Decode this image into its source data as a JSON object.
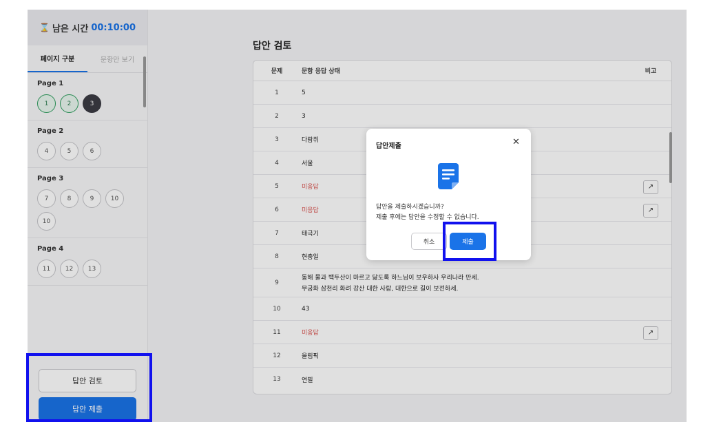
{
  "timer": {
    "label": "남은 시간",
    "value": "00:10:00"
  },
  "tabs": [
    {
      "label": "페이지 구분",
      "active": true
    },
    {
      "label": "문항만 보기",
      "active": false
    }
  ],
  "pages": [
    {
      "label": "Page 1",
      "questions": [
        {
          "n": "1",
          "state": "answered"
        },
        {
          "n": "2",
          "state": "answered"
        },
        {
          "n": "3",
          "state": "current"
        }
      ]
    },
    {
      "label": "Page 2",
      "questions": [
        {
          "n": "4",
          "state": ""
        },
        {
          "n": "5",
          "state": ""
        },
        {
          "n": "6",
          "state": ""
        }
      ]
    },
    {
      "label": "Page 3",
      "questions": [
        {
          "n": "7",
          "state": ""
        },
        {
          "n": "8",
          "state": ""
        },
        {
          "n": "9",
          "state": ""
        },
        {
          "n": "10",
          "state": ""
        },
        {
          "n": "10",
          "state": ""
        }
      ]
    },
    {
      "label": "Page 4",
      "questions": [
        {
          "n": "11",
          "state": ""
        },
        {
          "n": "12",
          "state": ""
        },
        {
          "n": "13",
          "state": ""
        }
      ]
    }
  ],
  "sidebar_buttons": {
    "review": "답안 검토",
    "submit": "답안 제출"
  },
  "main": {
    "title": "답안 검토",
    "columns": {
      "num": "문제",
      "status": "문항 응답 상태",
      "note": "비고"
    },
    "rows": [
      {
        "num": "1",
        "status": "5",
        "unanswered": false,
        "link": false
      },
      {
        "num": "2",
        "status": "3",
        "unanswered": false,
        "link": false
      },
      {
        "num": "3",
        "status": "다람쥐",
        "unanswered": false,
        "link": false
      },
      {
        "num": "4",
        "status": "서울",
        "unanswered": false,
        "link": false
      },
      {
        "num": "5",
        "status": "미응답",
        "unanswered": true,
        "link": true
      },
      {
        "num": "6",
        "status": "미응답",
        "unanswered": true,
        "link": true
      },
      {
        "num": "7",
        "status": "태극기",
        "unanswered": false,
        "link": false
      },
      {
        "num": "8",
        "status": "현충일",
        "unanswered": false,
        "link": false
      },
      {
        "num": "9",
        "status": "동해 물과 백두산이 마르고 닳도록 하느님이 보우하사 우리나라 만세.",
        "status2": "무궁화 삼천리 화려 강산 대한 사람, 대한으로 길이 보전하세.",
        "unanswered": false,
        "link": false
      },
      {
        "num": "10",
        "status": "43",
        "unanswered": false,
        "link": false
      },
      {
        "num": "11",
        "status": "미응답",
        "unanswered": true,
        "link": true
      },
      {
        "num": "12",
        "status": "올림픽",
        "unanswered": false,
        "link": false
      },
      {
        "num": "13",
        "status": "연필",
        "unanswered": false,
        "link": false
      }
    ],
    "link_icon": "↗"
  },
  "modal": {
    "title": "답안제출",
    "close": "✕",
    "message_line1": "답안을 제출하시겠습니까?",
    "message_line2": "제출 후에는 답안을 수정할 수 없습니다.",
    "cancel": "취소",
    "submit": "제출"
  },
  "colors": {
    "accent": "#1a73e8",
    "unanswered": "#d9534f",
    "answered": "#2e9e5e",
    "highlight": "#1111ee"
  }
}
